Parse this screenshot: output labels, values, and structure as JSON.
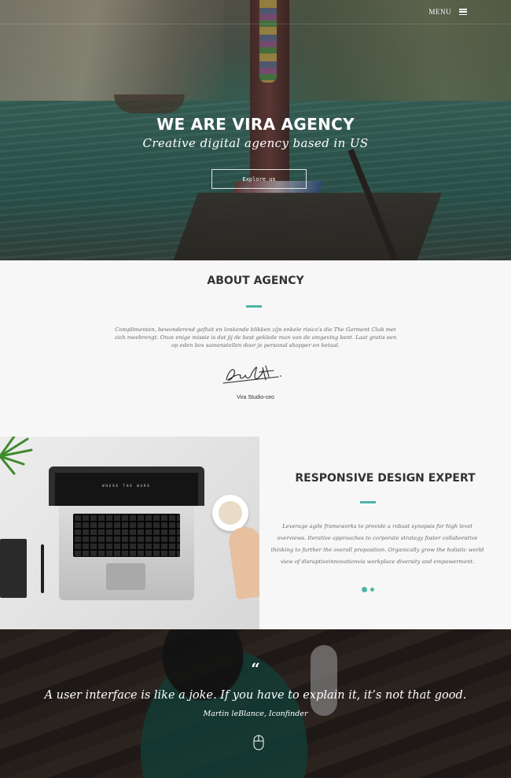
{
  "nav": {
    "menu_label": "MENU"
  },
  "hero": {
    "title": "WE ARE VIRA AGENCY",
    "subtitle": "Creative digital agency based in US",
    "button_label": "Explore us"
  },
  "about": {
    "title": "ABOUT AGENCY",
    "text": "Complimenten, bewonderend gefluit en lonkende blikken zijn enkele risico's die The Garment Club met zich meebrengt. Onze enige missie is dat jij de best geklede man van de omgeving bent. Laat gratis een op eden box samenstellen door je personal shopper en betaal.",
    "signature_icon": "signature-icon",
    "ceo_label": "Vira Studio-ceo"
  },
  "feature": {
    "title": "RESPONSIVE DESIGN EXPERT",
    "text": "Leverage agile frameworks to provide a robust synopsis for high level overviews. Iterative approaches to corporate strategy foster collaborative thinking to further the overall proposition. Organically grow the holistic world view of disruptiveinnovationvia workplace diversity and empowerment.",
    "laptop_screen_text": "WHERE THE WARE"
  },
  "quote": {
    "mark": "“",
    "text": "A user interface is like a joke. If you have to explain it, it’s not that good.",
    "author": "Martin leBlance, Iconfinder"
  },
  "colors": {
    "accent": "#4db6a3"
  }
}
